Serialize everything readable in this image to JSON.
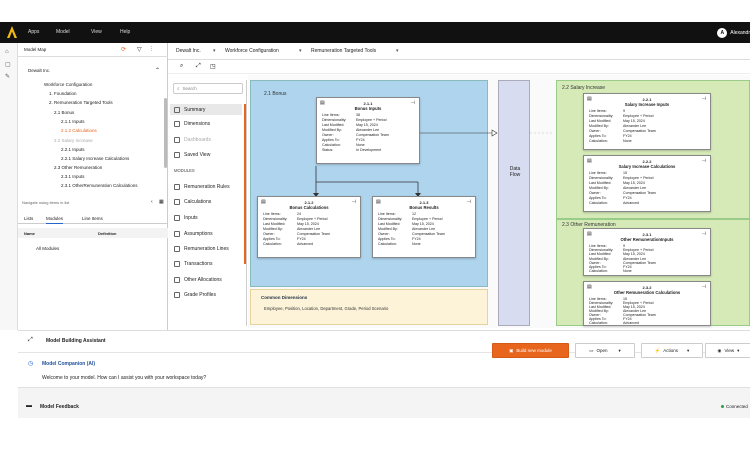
{
  "topbar": {
    "menu": [
      "Apps",
      "Model",
      "View",
      "Help"
    ],
    "user_initial": "A",
    "user_name": "Alexandr"
  },
  "left_panel": {
    "title": "Model Map",
    "tree": [
      {
        "label": "Dewalt Inc.",
        "level": 0
      },
      {
        "label": "Workforce Configuration",
        "level": 1
      },
      {
        "label": "1. Foundation",
        "level": 2
      },
      {
        "label": "2. Remuneration Targeted Tools",
        "level": 2
      },
      {
        "label": "2.1 Bonus",
        "level": 3
      },
      {
        "label": "2.1.1 Inputs",
        "level": 4
      },
      {
        "label": "2.1.2 Calculations",
        "level": 4,
        "selected": true
      },
      {
        "label": "2.2 Salary Increase",
        "level": 3
      },
      {
        "label": "2.2.1 Inputs",
        "level": 4
      },
      {
        "label": "2.2.1 Salary Increase Calculations",
        "level": 4
      },
      {
        "label": "2.3 Other Remuneration",
        "level": 3
      },
      {
        "label": "2.3.1 Inputs",
        "level": 4
      },
      {
        "label": "2.3.1 OtherRemuneration Calculations",
        "level": 4
      }
    ],
    "hint": "Navigate using items in list",
    "tabs": [
      "Lists",
      "Modules",
      "Line Items"
    ],
    "active_tab": "Modules",
    "columns": [
      "Name",
      "Definition"
    ],
    "rows": [
      "All Modules"
    ]
  },
  "main_header": {
    "breadcrumbs": [
      "Dewalt Inc.",
      "Workforce Configuration",
      "Remuneration Targeted Tools"
    ]
  },
  "nav": {
    "search_placeholder": "Search",
    "items": [
      "Summary",
      "Dimensions",
      "Dashboards",
      "Saved View"
    ],
    "modules_heading": "MODULES",
    "modules": [
      "Remuneration Rules",
      "Calculations",
      "Inputs",
      "Assumptions",
      "Remuneration Lines",
      "Transactions",
      "Other Allocations",
      "Grade Profiles"
    ]
  },
  "diagram": {
    "bonus_section": "2.1 Bonus",
    "salary_section": "2.2 Salary Increase",
    "other_section": "2.3 Other Remuneration",
    "data_flow": "Data Flow",
    "common_dims_title": "Common Dimensions",
    "common_dims_text": "Employee, Position, Location, Department, Grade, Period Scenario",
    "row_keys": [
      "Line Items:",
      "Dimensionality:",
      "Last Modified:",
      "Modified By:",
      "Owner:",
      "Applies To:",
      "Calculation:"
    ],
    "cards": [
      {
        "id": "bonus-inputs",
        "num": "2.1.1",
        "title": "Bonus Inputs",
        "values": [
          "38",
          "Employee + Period",
          "May 15, 2024",
          "Alexander Lee",
          "Compensation Team",
          "FY24",
          "None"
        ],
        "extra_key": "Status:",
        "extra_value": "In Development"
      },
      {
        "id": "bonus-calcs",
        "num": "2.1.2",
        "title": "Bonus Calculations",
        "values": [
          "24",
          "Employee + Period",
          "May 15, 2024",
          "Alexander Lee",
          "Compensation Team",
          "FY24",
          "Advanced"
        ]
      },
      {
        "id": "bonus-results",
        "num": "2.1.3",
        "title": "Bonus Results",
        "values": [
          "12",
          "Employee + Period",
          "May 15, 2024",
          "Alexander Lee",
          "Compensation Team",
          "FY24",
          "None"
        ]
      },
      {
        "id": "salary-inputs",
        "num": "2.2.1",
        "title": "Salary Increase Inputs",
        "values": [
          "9",
          "Employee + Period",
          "May 15, 2024",
          "Alexander Lee",
          "Compensation Team",
          "FY24",
          "None"
        ]
      },
      {
        "id": "salary-calcs",
        "num": "2.2.2",
        "title": "Salary Increase Calculations",
        "values": [
          "15",
          "Employee + Period",
          "May 15, 2024",
          "Alexander Lee",
          "Compensation Team",
          "FY24",
          "Advanced"
        ]
      },
      {
        "id": "other-inputs",
        "num": "2.3.1",
        "title": "Other RemunerationInputs",
        "values": [
          "9",
          "Employee + Period",
          "May 15, 2024",
          "Alexander Lee",
          "Compensation Team",
          "FY24",
          "None"
        ]
      },
      {
        "id": "other-calcs",
        "num": "2.3.2",
        "title": "Other Remuneration Calculations",
        "values": [
          "15",
          "Employee + Period",
          "May 15, 2024",
          "Alexander Lee",
          "Compensation Team",
          "FY24",
          "Advanced"
        ]
      }
    ]
  },
  "toolbar": {
    "build_label": "Build new module",
    "open_label": "Open",
    "actions_label": "Actions",
    "view_label": "View"
  },
  "assistant": {
    "title": "Model Building Assistant",
    "companion": "Model Companion (AI)",
    "message": "Welcome to your model. How can I assist you with your workspace today?",
    "feedback": "Model Feedback",
    "status": "Connected"
  },
  "colors": {
    "accent": "#e8651e",
    "bonus_bg": "#aed4ee",
    "salary_bg": "#d6eab8"
  }
}
